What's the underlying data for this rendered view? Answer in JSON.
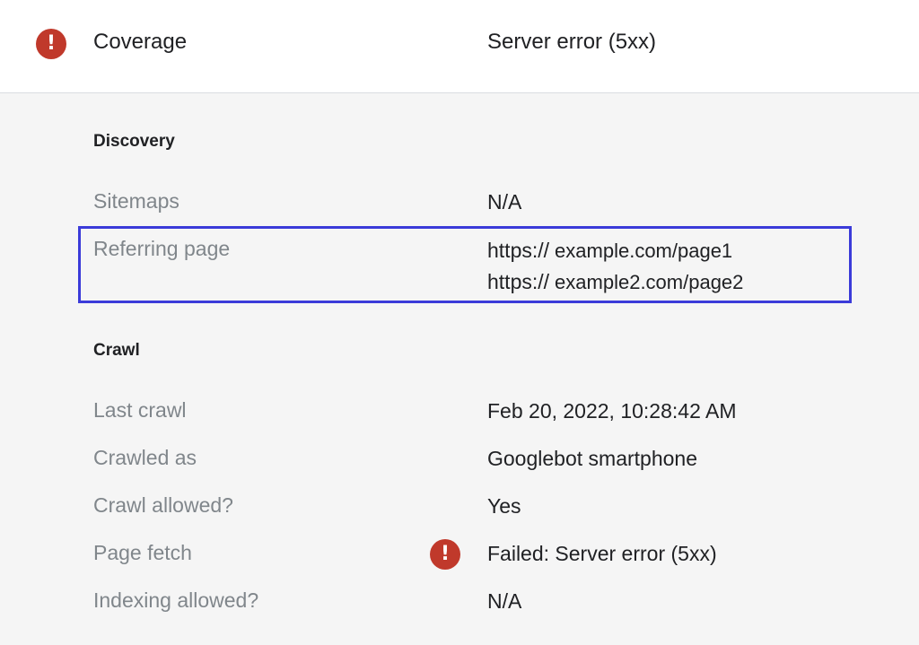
{
  "header": {
    "label": "Coverage",
    "value": "Server error (5xx)",
    "icon": "error-icon",
    "icon_glyph": "!"
  },
  "discovery": {
    "title": "Discovery",
    "rows": [
      {
        "label": "Sitemaps",
        "value": "N/A"
      },
      {
        "label": "Referring page",
        "values": [
          {
            "prefix": "https://",
            "rest": "example.com/page1"
          },
          {
            "prefix": "https://",
            "rest": "example2.com/page2"
          }
        ]
      }
    ]
  },
  "crawl": {
    "title": "Crawl",
    "rows": [
      {
        "label": "Last crawl",
        "value": "Feb 20, 2022, 10:28:42 AM"
      },
      {
        "label": "Crawled as",
        "value": "Googlebot smartphone"
      },
      {
        "label": "Crawl allowed?",
        "value": "Yes"
      },
      {
        "label": "Page fetch",
        "value": "Failed: Server error (5xx)",
        "icon": "error-icon",
        "icon_glyph": "!"
      },
      {
        "label": "Indexing allowed?",
        "value": "N/A"
      }
    ]
  },
  "colors": {
    "error": "#c0392b",
    "highlight": "#3b3bd9",
    "label_gray": "#80868b"
  }
}
